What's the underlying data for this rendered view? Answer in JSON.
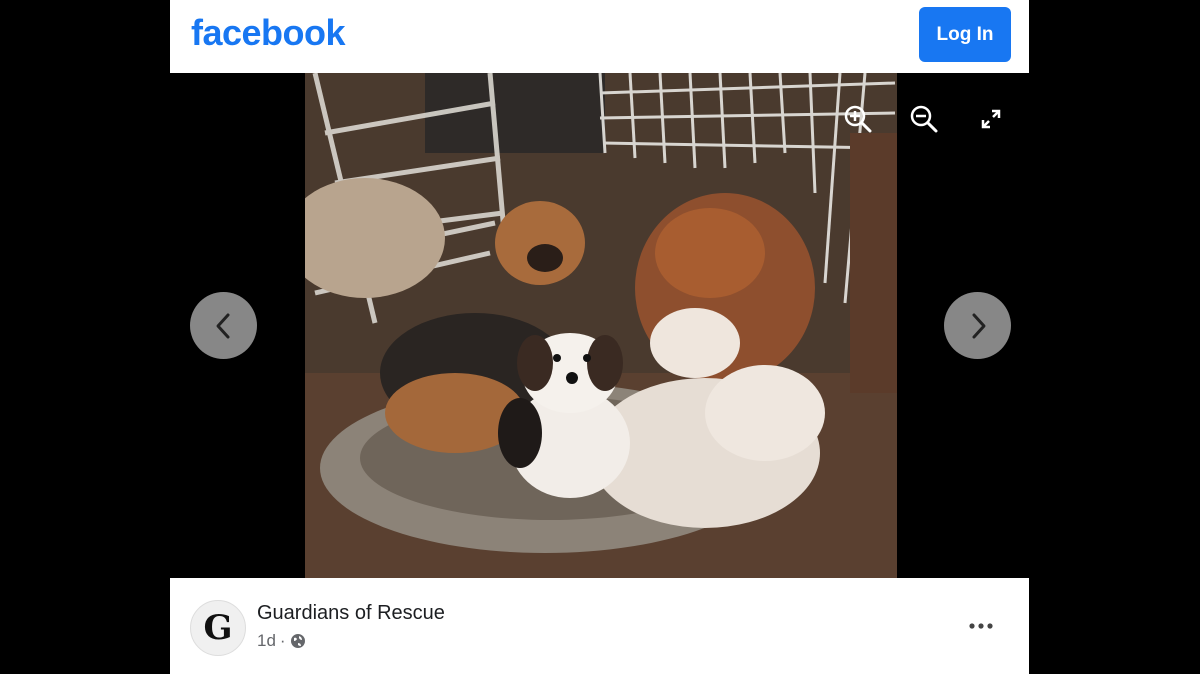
{
  "header": {
    "logo_text": "facebook",
    "login_label": "Log In"
  },
  "viewer": {
    "image_description": "Several small dogs huddled on a worn dog bed near wire crates",
    "icons": {
      "zoom_in": "zoom-in-icon",
      "zoom_out": "zoom-out-icon",
      "fullscreen": "fullscreen-icon",
      "prev": "chevron-left-icon",
      "next": "chevron-right-icon"
    }
  },
  "post": {
    "page_name": "Guardians of Rescue",
    "avatar_letter": "G",
    "timestamp": "1d",
    "separator": "·",
    "privacy_icon": "globe-icon",
    "more_icon": "more-options-icon"
  },
  "colors": {
    "brand": "#1877f2",
    "background": "#000000"
  }
}
